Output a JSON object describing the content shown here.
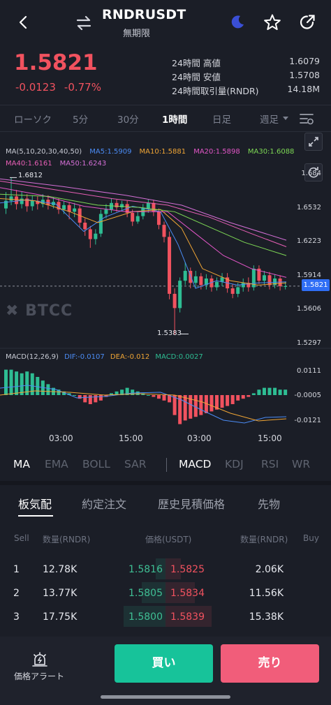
{
  "header": {
    "symbol": "RNDRUSDT",
    "subtitle": "無期限"
  },
  "price": {
    "last": "1.5821",
    "change": "-0.0123",
    "change_pct": "-0.77%"
  },
  "stats": [
    {
      "label": "24時間 高値",
      "value": "1.6079"
    },
    {
      "label": "24時間 安値",
      "value": "1.5708"
    },
    {
      "label": "24時間取引量(RNDR)",
      "value": "14.18M"
    }
  ],
  "timeframes": [
    "ローソク",
    "5分",
    "30分",
    "1時間",
    "日足",
    "週足"
  ],
  "active_timeframe": "1時間",
  "chart": {
    "ma_legend": {
      "title": "MA(5,10,20,30,40,50)",
      "ma5": "MA5:1.5909",
      "ma10": "MA10:1.5881",
      "ma20": "MA20:1.5898",
      "ma30": "MA30:1.6088",
      "ma40": "MA40:1.6161",
      "ma50": "MA50:1.6243"
    },
    "y_labels": [
      "1.684",
      "1.6532",
      "1.6223",
      "1.5914",
      "1.5606",
      "1.5297"
    ],
    "current_price_tag": "1.5821",
    "high_marker": "1.6812",
    "low_marker": "1.5383",
    "watermark": "BTCC",
    "macd_legend": {
      "title": "MACD(12,26,9)",
      "dif": "DIF:-0.0107",
      "dea": "DEA:-0.012",
      "macd": "MACD:0.0027"
    },
    "macd_y_labels": [
      "0.0111",
      "-0.0005",
      "-0.0121"
    ],
    "x_labels": [
      "03:00",
      "15:00",
      "03:00",
      "15:00"
    ],
    "colors": {
      "up": "#2ebd93",
      "down": "#f1525f",
      "ma5": "#4b8cf5",
      "ma10": "#f0a535",
      "ma20": "#e356c8",
      "ma30": "#7ed955",
      "ma40": "#e85fb6",
      "ma50": "#d46fd6"
    }
  },
  "indicators": {
    "main": [
      "MA",
      "EMA",
      "BOLL",
      "SAR"
    ],
    "sub": [
      "MACD",
      "KDJ",
      "RSI",
      "WR"
    ],
    "active_main": "MA",
    "active_sub": "MACD"
  },
  "orderbook": {
    "tabs": [
      "板気配",
      "約定注文",
      "歴史見積価格",
      "先物"
    ],
    "headers": {
      "sell": "Sell",
      "sell_qty": "数量(RNDR)",
      "price": "価格(USDT)",
      "buy_qty": "数量(RNDR)",
      "buy": "Buy"
    },
    "rows": [
      {
        "idx": "1",
        "bid_qty": "12.78K",
        "bid": "1.5816",
        "ask": "1.5825",
        "ask_qty": "2.06K",
        "bid_depth": 0.12,
        "ask_depth": 0.18
      },
      {
        "idx": "2",
        "bid_qty": "13.77K",
        "bid": "1.5805",
        "ask": "1.5834",
        "ask_qty": "11.56K",
        "bid_depth": 0.28,
        "ask_depth": 0.35
      },
      {
        "idx": "3",
        "bid_qty": "17.75K",
        "bid": "1.5800",
        "ask": "1.5839",
        "ask_qty": "15.38K",
        "bid_depth": 0.5,
        "ask_depth": 0.55
      }
    ]
  },
  "bottom": {
    "alert_label": "価格アラート",
    "buy_label": "買い",
    "sell_label": "売り"
  }
}
